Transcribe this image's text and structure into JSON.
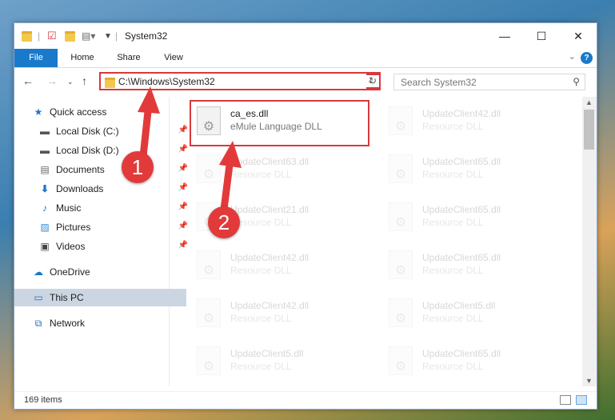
{
  "window": {
    "title": "System32"
  },
  "ribbon": {
    "tabs": [
      "File",
      "Home",
      "Share",
      "View"
    ]
  },
  "nav": {
    "address": "C:\\Windows\\System32",
    "search_placeholder": "Search System32"
  },
  "sidebar": {
    "items": [
      {
        "label": "Quick access",
        "icon": "star-icon"
      },
      {
        "label": "Local Disk (C:)",
        "icon": "drive-icon",
        "pinned": true
      },
      {
        "label": "Local Disk (D:)",
        "icon": "drive-icon",
        "pinned": true
      },
      {
        "label": "Documents",
        "icon": "documents-icon",
        "pinned": true
      },
      {
        "label": "Downloads",
        "icon": "download-icon",
        "pinned": true
      },
      {
        "label": "Music",
        "icon": "music-icon",
        "pinned": true
      },
      {
        "label": "Pictures",
        "icon": "pictures-icon",
        "pinned": true
      },
      {
        "label": "Videos",
        "icon": "videos-icon",
        "pinned": true
      },
      {
        "label": "OneDrive",
        "icon": "cloud-icon"
      },
      {
        "label": "This PC",
        "icon": "computer-icon",
        "selected": true
      },
      {
        "label": "Network",
        "icon": "network-icon"
      }
    ]
  },
  "files": [
    {
      "name": "ca_es.dll",
      "desc": "eMule Language DLL",
      "highlight": true
    },
    {
      "name": "UpdateClient42.dll",
      "desc": "Resource DLL"
    },
    {
      "name": "UpdateClient63.dll",
      "desc": "Resource DLL"
    },
    {
      "name": "UpdateClient65.dll",
      "desc": "Resource DLL"
    },
    {
      "name": "UpdateClient21.dll",
      "desc": "Resource DLL"
    },
    {
      "name": "UpdateClient65.dll",
      "desc": "Resource DLL"
    },
    {
      "name": "UpdateClient42.dll",
      "desc": "Resource DLL"
    },
    {
      "name": "UpdateClient65.dll",
      "desc": "Resource DLL"
    },
    {
      "name": "UpdateClient42.dll",
      "desc": "Resource DLL"
    },
    {
      "name": "UpdateClient5.dll",
      "desc": "Resource DLL"
    },
    {
      "name": "UpdateClient5.dll",
      "desc": "Resource DLL"
    },
    {
      "name": "UpdateClient65.dll",
      "desc": "Resource DLL"
    }
  ],
  "status": {
    "item_count": "169 items"
  },
  "annotations": {
    "step1": "1",
    "step2": "2"
  },
  "colors": {
    "accent": "#1979ca",
    "annotation": "#e23a3a"
  }
}
